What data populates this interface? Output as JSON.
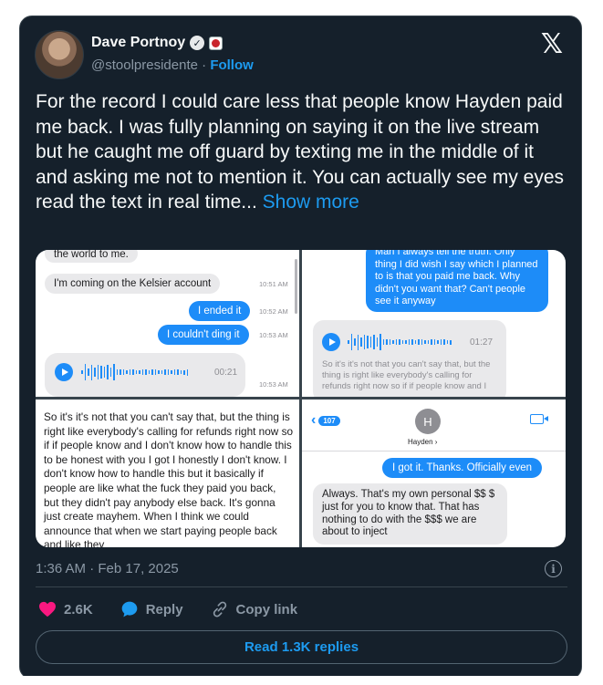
{
  "author": {
    "name": "Dave Portnoy",
    "handle": "@stoolpresidente",
    "follow_label": "Follow",
    "separator": "·"
  },
  "tweet": {
    "text": "For the record I could care less that people know Hayden paid me back. I was fully planning on saying it on the live stream but he caught me off guard by texting me in the middle of it and asking me not to mention it.  You can actually see my eyes read the text in real time...",
    "show_more": "Show more",
    "timestamp": "1:36 AM · Feb 17, 2025"
  },
  "media": {
    "q1": {
      "top_text": "the world to me.",
      "kelsier": "I'm coming on the Kelsier account",
      "ended": "I ended it",
      "ding": "I couldn't ding it",
      "ts1": "10:51 AM",
      "ts2": "10:52 AM",
      "ts3": "10:53 AM",
      "ts4": "10:53 AM",
      "duration": "00:21"
    },
    "q2": {
      "blue_text": "Man I always tell the truth.  Only thing I did wish I say which I planned to is that you paid me back.  Why didn't you want that? Can't people see it anyway",
      "duration": "01:27",
      "faded": "So it's it's not that you can't say that, but the thing is right like everybody's calling for refunds right now so if if people know and I"
    },
    "q3": {
      "text": "So it's it's not that you can't say that, but the thing is right like everybody's calling for refunds right now so if if people know and I don't know how to handle this to be honest with you I got I honestly I don't know. I don't know how to handle this but it basically if people are like what the fuck they paid you back, but they didn't pay anybody else back. It's gonna just create mayhem. When I think we could announce that when we start paying people back and like they"
    },
    "q4": {
      "back_count": "107",
      "avatar_letter": "H",
      "contact": "Hayden ›",
      "got_it": "I got it.  Thanks.  Officially even",
      "reply": "Always. That's my own personal $$ $ just for you to know that. That has nothing to do with the $$$ we are about to inject"
    }
  },
  "actions": {
    "likes": "2.6K",
    "reply": "Reply",
    "copy_link": "Copy link",
    "read_replies": "Read 1.3K replies"
  },
  "colors": {
    "background": "#15202b",
    "accent": "#1d9bf0",
    "like": "#f91880",
    "imessage_blue": "#1d8cf8"
  },
  "icons": [
    "verified-icon",
    "x-logo-icon",
    "info-icon",
    "heart-icon",
    "reply-icon",
    "link-icon",
    "play-icon",
    "camera-icon"
  ]
}
